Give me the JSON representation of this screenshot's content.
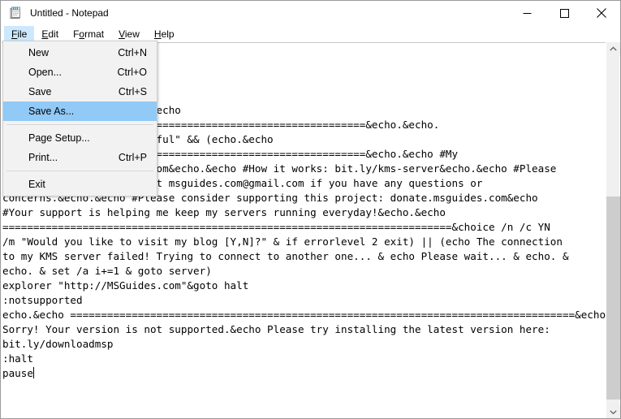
{
  "window": {
    "title": "Untitled - Notepad",
    "app_icon": "notepad-icon"
  },
  "window_controls": {
    "minimize": "minimize-icon",
    "maximize": "maximize-icon",
    "close": "close-icon"
  },
  "menubar": {
    "items": [
      {
        "label": "File",
        "accel_letter": "F",
        "open": true
      },
      {
        "label": "Edit",
        "accel_letter": "E",
        "open": false
      },
      {
        "label": "Format",
        "accel_letter": "o",
        "open": false
      },
      {
        "label": "View",
        "accel_letter": "V",
        "open": false
      },
      {
        "label": "Help",
        "accel_letter": "H",
        "open": false
      }
    ]
  },
  "file_menu": {
    "items": [
      {
        "label": "New",
        "accel": "Ctrl+N",
        "selected": false,
        "separator_after": false
      },
      {
        "label": "Open...",
        "accel": "Ctrl+O",
        "selected": false,
        "separator_after": false
      },
      {
        "label": "Save",
        "accel": "Ctrl+S",
        "selected": false,
        "separator_after": false
      },
      {
        "label": "Save As...",
        "accel": "",
        "selected": true,
        "separator_after": true
      },
      {
        "label": "Page Setup...",
        "accel": "",
        "selected": false,
        "separator_after": false
      },
      {
        "label": "Print...",
        "accel": "Ctrl+P",
        "selected": false,
        "separator_after": true
      },
      {
        "label": "Exit",
        "accel": "",
        "selected": false,
        "separator_after": false
      }
    ],
    "highlight_color": "#91c9f7"
  },
  "editor": {
    "text": "s7.MSGuides.com\ns8.MSGuides.com\ns9.MSGuides.com\nted\ns /sethst:%KMS_Sev% >nul&echo\n===========================================================&echo.&echo.\ns /act | find /i \"successful\" && (echo.&echo\n===========================================================&echo.&echo #My\nofficial blog: MSGuides.com&echo.&echo #How it works: bit.ly/kms-server&echo.&echo #Please\nfeel free to contact me at msguides.com@gmail.com if you have any questions or\nconcerns.&echo.&echo #Please consider supporting this project: donate.msguides.com&echo\n#Your support is helping me keep my servers running everyday!&echo.&echo\n=========================================================================&choice /n /c YN\n/m \"Would you like to visit my blog [Y,N]?\" & if errorlevel 2 exit) || (echo The connection\nto my KMS server failed! Trying to connect to another one... & echo Please wait... & echo. &\necho. & set /a i+=1 & goto server)\nexplorer \"http://MSGuides.com\"&goto halt\n:notsupported\necho.&echo ==================================================================================&echo\nSorry! Your version is not supported.&echo Please try installing the latest version here:\nbit.ly/downloadmsp\n:halt\npause",
    "caret_visible": true
  },
  "scrollbar": {
    "up_arrow": "chevron-up-icon",
    "down_arrow": "chevron-down-icon",
    "thumb_color": "#cdcdcd",
    "track_color": "#f0f0f0"
  }
}
